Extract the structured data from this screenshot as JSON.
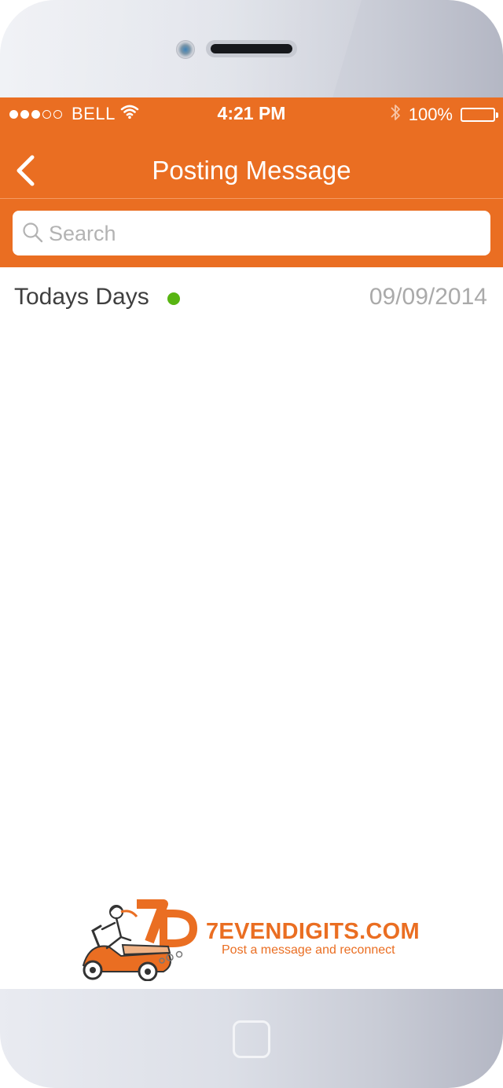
{
  "status_bar": {
    "signal_dots": "●●●○○",
    "carrier": "BELL",
    "time": "4:21 PM",
    "battery": "100%",
    "icons": [
      "wifi-icon",
      "bluetooth-icon",
      "battery-icon"
    ]
  },
  "nav": {
    "title": "Posting Message",
    "back_icon": "chevron-left-icon"
  },
  "search": {
    "placeholder": "Search",
    "icon": "search-icon"
  },
  "messages": [
    {
      "title": "Todays Days",
      "date": "09/09/2014",
      "status_color": "#58b512"
    }
  ],
  "footer": {
    "brand": "7EVENDIGITS.COM",
    "tagline": "Post a message and reconnect",
    "logo_mark": "7D"
  },
  "colors": {
    "accent": "#ea6e22",
    "status_online": "#58b512",
    "title_text": "#3f3f3f",
    "date_text": "#aaaaaa"
  }
}
